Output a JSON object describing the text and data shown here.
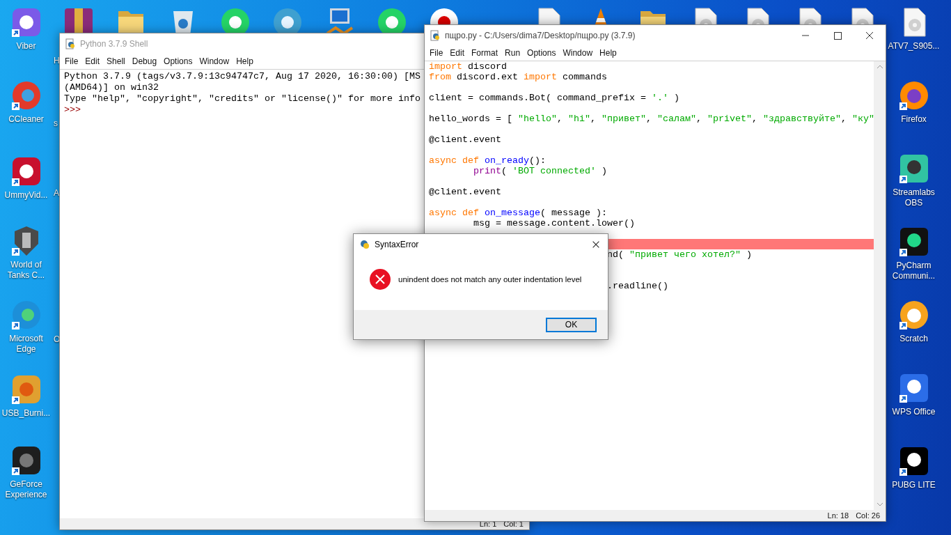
{
  "desktop": {
    "left_icons": [
      {
        "label": "Viber"
      },
      {
        "label": "CCleaner"
      },
      {
        "label": "UmmyVid..."
      },
      {
        "label": "World of Tanks C..."
      },
      {
        "label": "Microsoft Edge"
      },
      {
        "label": "USB_Burni..."
      },
      {
        "label": "GeForce Experience"
      }
    ],
    "hidden_icon_label_fragments": [
      "H",
      "s",
      "A",
      "O"
    ],
    "top_icons": [
      {
        "label": "ATV7_S905..."
      }
    ],
    "right_icons": [
      {
        "label": "Firefox"
      },
      {
        "label": "Streamlabs OBS"
      },
      {
        "label": "PyCharm Communi..."
      },
      {
        "label": "Scratch"
      },
      {
        "label": "WPS Office"
      },
      {
        "label": "PUBG LITE"
      }
    ]
  },
  "shell": {
    "title": "Python 3.7.9 Shell",
    "menu": [
      "File",
      "Edit",
      "Shell",
      "Debug",
      "Options",
      "Window",
      "Help"
    ],
    "lines": [
      {
        "text": "Python 3.7.9 (tags/v3.7.9:13c94747c7, Aug 17 2020, 16:30:00) [MS",
        "kind": "output"
      },
      {
        "text": "(AMD64)] on win32",
        "kind": "output"
      },
      {
        "text": "Type \"help\", \"copyright\", \"credits\" or \"license()\" for more info",
        "kind": "output"
      },
      {
        "text": ">>>",
        "kind": "prompt"
      }
    ],
    "status": {
      "line": "Ln: 1",
      "column": "Col: 1"
    }
  },
  "editor": {
    "title": "пщро.py - C:/Users/dima7/Desktop/пщро.py (3.7.9)",
    "menu": [
      "File",
      "Edit",
      "Format",
      "Run",
      "Options",
      "Window",
      "Help"
    ],
    "lines": [
      {
        "error": false,
        "tokens": [
          {
            "text": "import",
            "kind": "keyword"
          },
          {
            "text": " discord",
            "kind": "plain"
          }
        ]
      },
      {
        "error": false,
        "tokens": [
          {
            "text": "from",
            "kind": "keyword"
          },
          {
            "text": " discord.ext ",
            "kind": "plain"
          },
          {
            "text": "import",
            "kind": "keyword"
          },
          {
            "text": " commands",
            "kind": "plain"
          }
        ]
      },
      {
        "error": false
      },
      {
        "error": false,
        "tokens": [
          {
            "text": "client = commands.Bot( command_prefix = ",
            "kind": "plain"
          },
          {
            "text": "'.'",
            "kind": "string"
          },
          {
            "text": " )",
            "kind": "plain"
          }
        ]
      },
      {
        "error": false
      },
      {
        "error": false,
        "tokens": [
          {
            "text": "hello_words = [ ",
            "kind": "plain"
          },
          {
            "text": "\"hello\"",
            "kind": "string"
          },
          {
            "text": ", ",
            "kind": "plain"
          },
          {
            "text": "\"hi\"",
            "kind": "string"
          },
          {
            "text": ", ",
            "kind": "plain"
          },
          {
            "text": "\"привет\"",
            "kind": "string"
          },
          {
            "text": ", ",
            "kind": "plain"
          },
          {
            "text": "\"салам\"",
            "kind": "string"
          },
          {
            "text": ", ",
            "kind": "plain"
          },
          {
            "text": "\"privet\"",
            "kind": "string"
          },
          {
            "text": ", ",
            "kind": "plain"
          },
          {
            "text": "\"здравствуйте\"",
            "kind": "string"
          },
          {
            "text": ", ",
            "kind": "plain"
          },
          {
            "text": "\"ку\"",
            "kind": "string"
          }
        ]
      },
      {
        "error": false
      },
      {
        "error": false,
        "tokens": [
          {
            "text": "@client.event",
            "kind": "plain"
          }
        ]
      },
      {
        "error": false
      },
      {
        "error": false,
        "tokens": [
          {
            "text": "async def",
            "kind": "keyword"
          },
          {
            "text": " on_ready",
            "kind": "definition"
          },
          {
            "text": "():",
            "kind": "plain"
          }
        ]
      },
      {
        "error": false,
        "tokens": [
          {
            "text": "        print",
            "kind": "builtin"
          },
          {
            "text": "( ",
            "kind": "plain"
          },
          {
            "text": "'BOT connected'",
            "kind": "string"
          },
          {
            "text": " )",
            "kind": "plain"
          }
        ]
      },
      {
        "error": false
      },
      {
        "error": false,
        "tokens": [
          {
            "text": "@client.event",
            "kind": "plain"
          }
        ]
      },
      {
        "error": false
      },
      {
        "error": false,
        "tokens": [
          {
            "text": "async def",
            "kind": "keyword"
          },
          {
            "text": " on_message",
            "kind": "definition"
          },
          {
            "text": "( message ):",
            "kind": "plain"
          }
        ]
      },
      {
        "error": false,
        "tokens": [
          {
            "text": "        msg = message.content.lower()",
            "kind": "plain"
          }
        ]
      },
      {
        "error": false
      },
      {
        "error": true
      },
      {
        "error": false,
        "tokens": [
          {
            "text": "                                nd( ",
            "kind": "plain"
          },
          {
            "text": "\"привет чего хотел?\"",
            "kind": "string"
          },
          {
            "text": " )",
            "kind": "plain"
          }
        ]
      },
      {
        "error": false
      },
      {
        "error": false
      },
      {
        "error": false,
        "tokens": [
          {
            "text": "                                .readline()",
            "kind": "plain"
          }
        ]
      }
    ],
    "status": {
      "line": "Ln: 18",
      "column": "Col: 26"
    }
  },
  "dialog": {
    "title": "SyntaxError",
    "message": "unindent does not match any outer indentation level",
    "button": "OK"
  }
}
